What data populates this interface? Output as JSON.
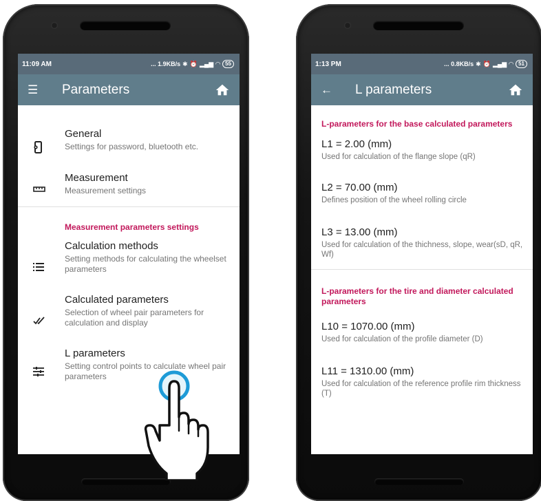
{
  "left_phone": {
    "status": {
      "time": "11:09 AM",
      "network": "... 1.9KB/s",
      "battery": "55"
    },
    "toolbar": {
      "title": "Parameters",
      "nav_icon": "menu-icon",
      "action_icon": "home-icon"
    },
    "items": [
      {
        "title": "General",
        "subtitle": "Settings for password, bluetooth etc.",
        "icon": "device-settings-icon"
      },
      {
        "title": "Measurement",
        "subtitle": "Measurement settings",
        "icon": "ruler-icon"
      }
    ],
    "section_header": "Measurement parameters settings",
    "section_items": [
      {
        "title": "Calculation methods",
        "subtitle": "Setting methods for calculating the wheelset parameters",
        "icon": "list-icon"
      },
      {
        "title": "Calculated parameters",
        "subtitle": "Selection of wheel pair parameters for calculation and display",
        "icon": "double-check-icon"
      },
      {
        "title": "L parameters",
        "subtitle": "Setting control points to calculate wheel pair parameters",
        "icon": "tune-icon"
      }
    ]
  },
  "right_phone": {
    "status": {
      "time": "1:13 PM",
      "network": "... 0.8KB/s",
      "battery": "51"
    },
    "toolbar": {
      "title": "L parameters",
      "nav_icon": "back-arrow-icon",
      "action_icon": "home-icon"
    },
    "section1_header": "L-parameters for the base calculated parameters",
    "section1_items": [
      {
        "value": "L1 = 2.00 (mm)",
        "description": "Used for calculation of the flange slope (qR)"
      },
      {
        "value": "L2 = 70.00 (mm)",
        "description": "Defines position of the wheel rolling circle"
      },
      {
        "value": "L3 = 13.00 (mm)",
        "description": "Used for calculation of the thichness, slope, wear(sD, qR, Wf)"
      }
    ],
    "section2_header": "L-parameters for the tire and diameter calculated parameters",
    "section2_items": [
      {
        "value": "L10 = 1070.00 (mm)",
        "description": "Used for calculation of the profile diameter (D)"
      },
      {
        "value": "L11 = 1310.00 (mm)",
        "description": "Used for calculation of the reference profile rim thickness (T)"
      }
    ]
  },
  "overlay": {
    "icon": "tap-hand-icon"
  },
  "colors": {
    "toolbar": "#607d8b",
    "statusbar": "#596b79",
    "accent": "#c2185b",
    "tap_ring": "#1e9bd7"
  }
}
